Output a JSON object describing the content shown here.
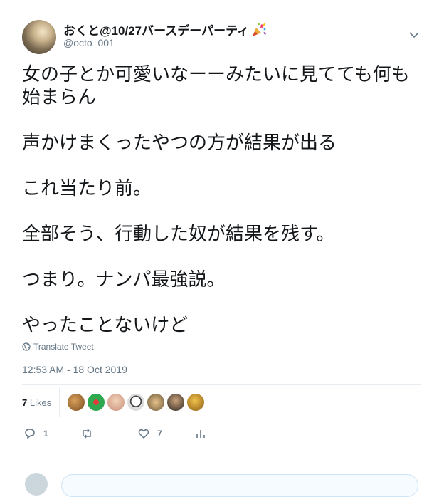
{
  "tweet": {
    "display_name": "おくと@10/27バースデーパーティ",
    "handle": "@octo_001",
    "body": [
      "女の子とか可愛いなーーみたいに見てても何も始まらん",
      "声かけまくったやつの方が結果が出る",
      "これ当たり前。",
      "全部そう、行動した奴が結果を残す。",
      "つまり。ナンパ最強説。",
      "やったことないけど"
    ],
    "translate_label": "Translate Tweet",
    "timestamp": "12:53 AM - 18 Oct 2019",
    "likes_count": "7",
    "likes_label": "Likes",
    "reply_count": "1",
    "like_action_count": "7",
    "icons": {
      "party": "party-popper-icon",
      "caret": "chevron-down-icon",
      "globe": "globe-icon",
      "reply": "reply-icon",
      "retweet": "retweet-icon",
      "like": "heart-icon",
      "analytics": "analytics-icon"
    },
    "colors": {
      "text": "#14171a",
      "secondary": "#657786",
      "divider": "#e6ecf0"
    }
  }
}
